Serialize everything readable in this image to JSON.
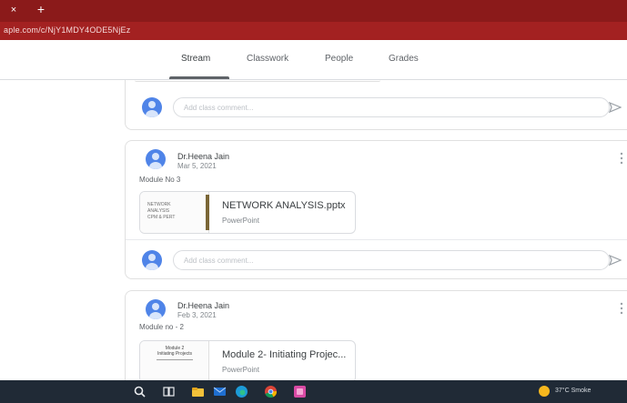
{
  "browser": {
    "url": "aple.com/c/NjY1MDY4ODE5NjEz",
    "close_glyph": "×",
    "new_tab_glyph": "+"
  },
  "nav": {
    "tabs": [
      {
        "label": "Stream",
        "active": true
      },
      {
        "label": "Classwork",
        "active": false
      },
      {
        "label": "People",
        "active": false
      },
      {
        "label": "Grades",
        "active": false
      }
    ]
  },
  "comment_placeholder": "Add class comment...",
  "posts": [
    {
      "author": "Dr.Heena Jain",
      "date": "Mar 5, 2021",
      "body": "Module No 3",
      "attachment": {
        "title": "NETWORK ANALYSIS.pptx",
        "type": "PowerPoint",
        "thumbnail_lines": [
          "NETWORK",
          "ANALYSIS",
          "CPM & PERT"
        ]
      }
    },
    {
      "author": "Dr.Heena Jain",
      "date": "Feb 3, 2021",
      "body": "Module no - 2",
      "attachment": {
        "title": "Module 2- Initiating Projec...",
        "type": "PowerPoint",
        "thumbnail_lines": [
          "Module 2",
          "Initiating Projects"
        ]
      }
    }
  ],
  "taskbar": {
    "weather": "37°C  Smoke",
    "icons": [
      "search-icon",
      "task-view-icon",
      "file-explorer-icon",
      "edge-icon",
      "chrome-icon",
      "app-icon"
    ]
  },
  "colors": {
    "chrome_red": "#8b1a1a",
    "accent_blue": "#4f84e8",
    "taskbar": "#202a36"
  }
}
